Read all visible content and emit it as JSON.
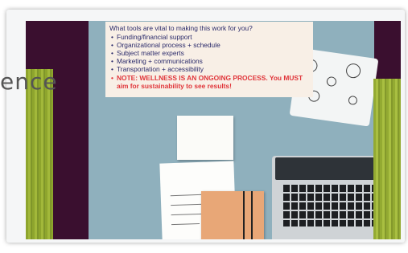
{
  "slide": {
    "side_text": "ence",
    "callout": {
      "question": "What tools are vital to making this work for you?",
      "items": [
        "Funding/financial support",
        "Organizational process + schedule",
        "Subject matter experts",
        "Marketing + communications",
        "Transportation + accessibility"
      ],
      "warning": "NOTE: WELLNESS IS AN ONGOING PROCESS. You MUST aim for sustainability to see results!"
    }
  },
  "colors": {
    "slide_background": "#3a0f2f",
    "accent_green": "#9bb238",
    "callout_background": "#f8efe6",
    "callout_text": "#2a2a6a",
    "warning_text": "#e0353a"
  }
}
